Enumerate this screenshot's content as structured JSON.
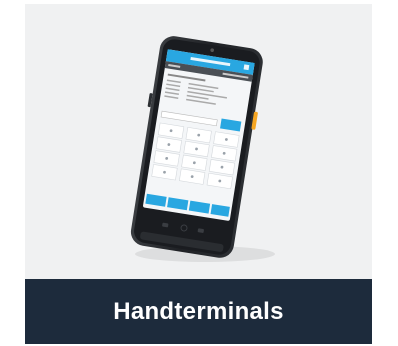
{
  "card": {
    "caption": "Handterminals",
    "colors": {
      "caption_bg": "#1d2b3c",
      "caption_text": "#ffffff",
      "card_bg": "#f0f1f2",
      "accent": "#29a7e1",
      "side_button": "#f5a623"
    },
    "device_icon": "rugged-handheld-terminal"
  }
}
